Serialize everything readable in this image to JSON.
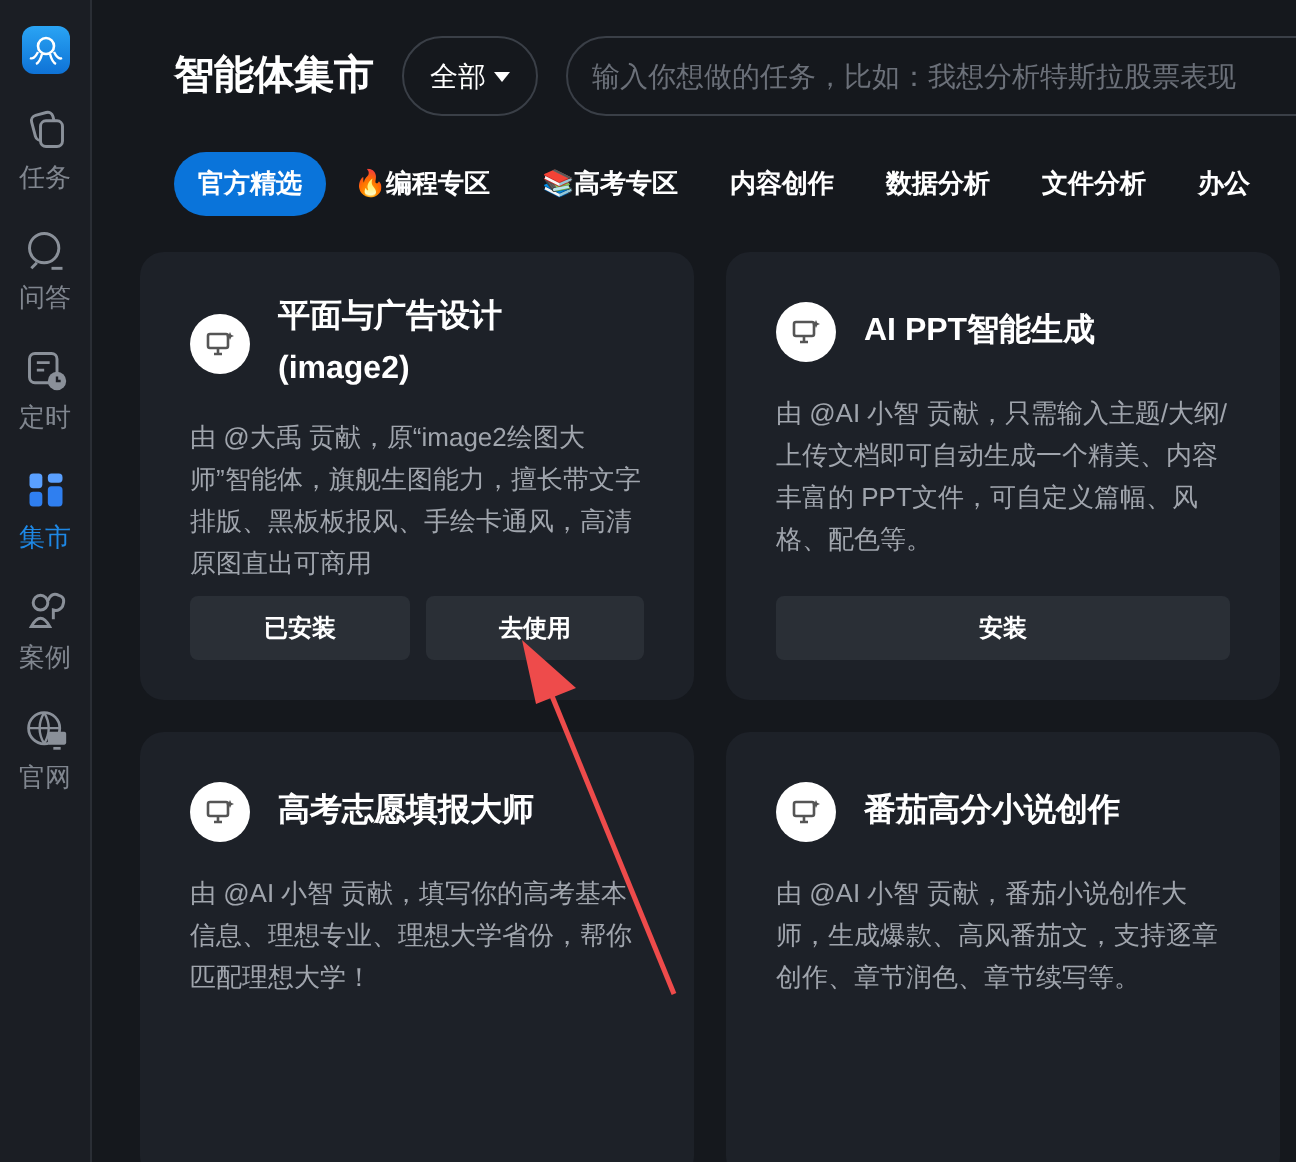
{
  "sidebar": {
    "items": [
      {
        "label": "任务",
        "selected": false
      },
      {
        "label": "问答",
        "selected": false
      },
      {
        "label": "定时",
        "selected": false
      },
      {
        "label": "集市",
        "selected": true
      },
      {
        "label": "案例",
        "selected": false
      },
      {
        "label": "官网",
        "selected": false
      }
    ]
  },
  "header": {
    "title": "智能体集市",
    "filter": "全部",
    "search": {
      "placeholder": "输入你想做的任务，比如：我想分析特斯拉股票表现"
    }
  },
  "tabs": [
    {
      "label": "官方精选",
      "selected": true
    },
    {
      "label": "编程专区",
      "emoji": "🔥",
      "selected": false
    },
    {
      "label": "高考专区",
      "emoji": "📚",
      "selected": false
    },
    {
      "label": "内容创作",
      "selected": false
    },
    {
      "label": "数据分析",
      "selected": false
    },
    {
      "label": "文件分析",
      "selected": false
    },
    {
      "label": "办公",
      "selected": false
    }
  ],
  "cards": [
    {
      "title": "平面与广告设计 (image2)",
      "description": "由 @大禹 贡献，原“image2绘图大师”智能体，旗舰生图能力，擅长带文字排版、黑板板报风、手绘卡通风，高清原图直出可商用",
      "buttons": [
        "已安装",
        "去使用"
      ]
    },
    {
      "title": "AI PPT智能生成",
      "description": "由 @AI 小智 贡献，只需输入主题/大纲/上传文档即可自动生成一个精美、内容丰富的 PPT文件，可自定义篇幅、风格、配色等。",
      "buttons": [
        "安装"
      ]
    },
    {
      "title": "高考志愿填报大师",
      "description": "由 @AI 小智 贡献，填写你的高考基本信息、理想专业、理想大学省份，帮你匹配理想大学！"
    },
    {
      "title": "番茄高分小说创作",
      "description": "由 @AI 小智 贡献，番茄小说创作大师，生成爆款、高风番茄文，支持逐章创作、章节润色、章节续写等。"
    }
  ]
}
